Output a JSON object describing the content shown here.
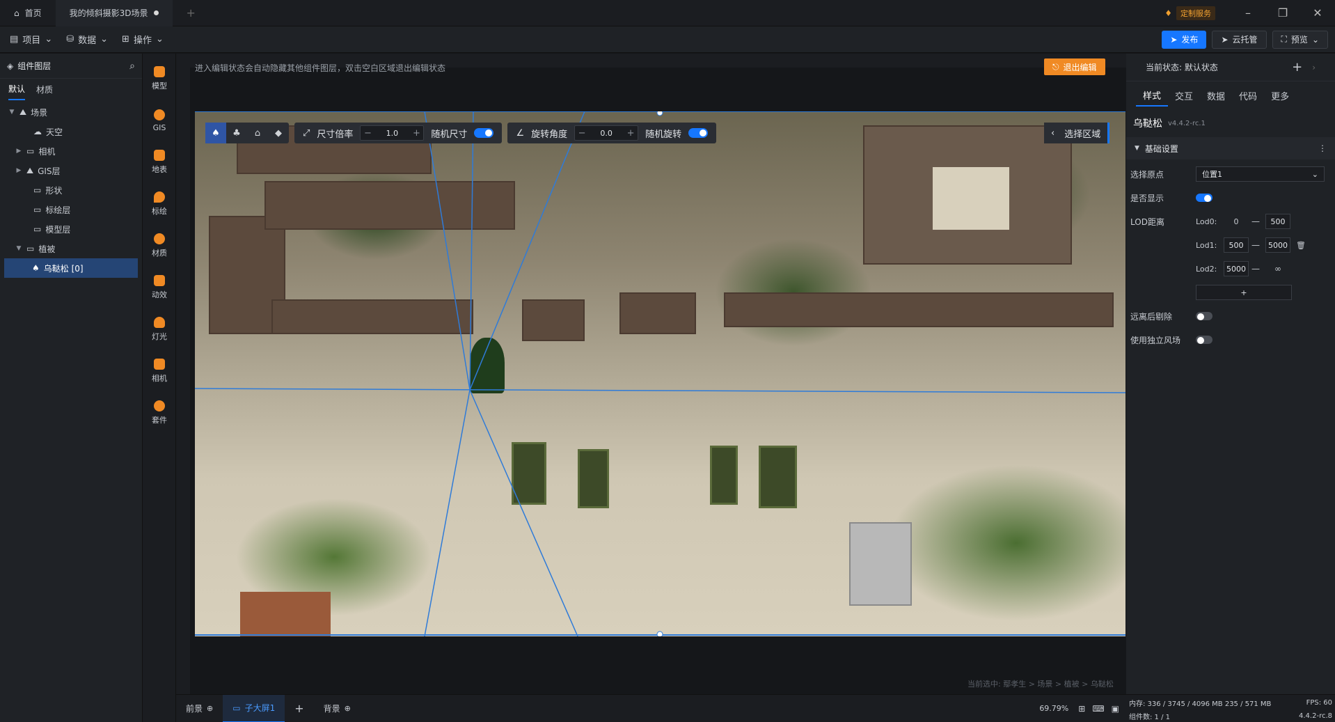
{
  "tabs": {
    "home": "首页",
    "project": "我的倾斜摄影3D场景"
  },
  "topright": {
    "service": "定制服务"
  },
  "toolbar": {
    "project": "项目",
    "data": "数据",
    "ops": "操作",
    "publish": "发布",
    "cloud": "云托管",
    "preview": "预览"
  },
  "left": {
    "title": "组件图层",
    "tabs": [
      "默认",
      "材质"
    ],
    "tree": [
      {
        "label": "场景"
      },
      {
        "label": "天空"
      },
      {
        "label": "相机"
      },
      {
        "label": "GIS层"
      },
      {
        "label": "形状"
      },
      {
        "label": "标绘层"
      },
      {
        "label": "模型层"
      },
      {
        "label": "植被"
      },
      {
        "label": "乌鞑松 [0]"
      }
    ]
  },
  "rail": [
    "模型",
    "GIS",
    "地表",
    "标绘",
    "材质",
    "动效",
    "灯光",
    "相机",
    "套件"
  ],
  "canvas": {
    "hint": "进入编辑状态会自动隐藏其他组件图层，双击空白区域退出编辑状态",
    "exit": "退出编辑",
    "size_label": "尺寸倍率",
    "size_value": "1.0",
    "random_size": "随机尺寸",
    "rotate_label": "旋转角度",
    "rotate_value": "0.0",
    "random_rotate": "随机旋转",
    "select_area": "选择区域",
    "breadcrumb": "当前选中: 鄢孝生 > 场景 > 植被 > 乌鞑松"
  },
  "bottom": {
    "front": "前景",
    "screen": "子大屏1",
    "back": "背景",
    "zoom": "69.79%"
  },
  "right": {
    "state": "当前状态: 默认状态",
    "tabs": [
      "样式",
      "交互",
      "数据",
      "代码",
      "更多"
    ],
    "comp_name": "乌鞑松",
    "comp_version": "v4.4.2-rc.1",
    "section": "基础设置",
    "origin_label": "选择原点",
    "origin_value": "位置1",
    "visible_label": "是否显示",
    "lod_label": "LOD距离",
    "lod0": {
      "name": "Lod0:",
      "a": "0",
      "b": "500"
    },
    "lod1": {
      "name": "Lod1:",
      "a": "500",
      "b": "5000"
    },
    "lod2": {
      "name": "Lod2:",
      "a": "5000",
      "b": "∞"
    },
    "add": "+",
    "far_remove": "远离后剔除",
    "wind": "使用独立风场"
  },
  "status": {
    "mem": "内存: 336 / 3745 / 4096 MB  235 / 571 MB",
    "fps": "FPS: 60",
    "count": "组件数: 1 / 1",
    "version": "4.4.2-rc.8"
  }
}
